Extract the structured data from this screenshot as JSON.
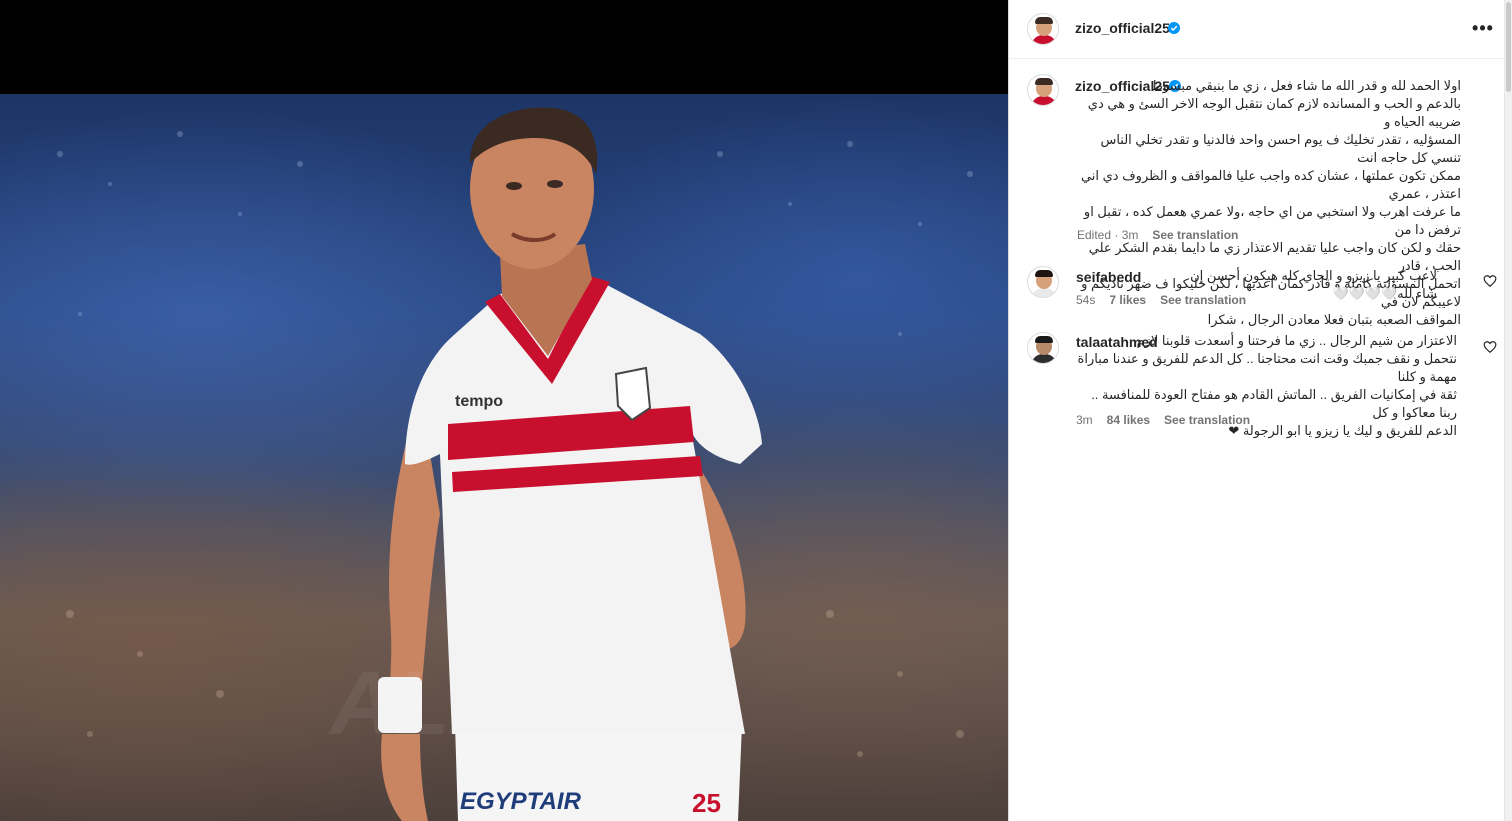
{
  "post": {
    "author": "zizo_official25",
    "verified": true,
    "caption": "اولا الحمد لله و قدر الله ما شاء فعل ، زي ما بنبقي مبسوط\nبالدعم و الحب و المسانده لازم كمان نتقبل الوجه الاخر السئ و هي دي ضريبه الحياه و\nالمسؤليه ، تقدر تخليك ف يوم احسن واحد فالدنيا و تقدر تخلي الناس تنسي كل حاجه انت\nممكن تكون عملتها ، عشان كده واجب عليا فالمواقف و الظروف دي اني اعتذر ، عمري\nما عرفت اهرب ولا استخبي من اي حاجه ،ولا عمري هعمل كده ، تقبل او ترفض دا من\nحقك و لكن كان واجب عليا تقديم الاعتذار زي ما دايما بقدم الشكر علي الحب ، قادر\nاتحمل المسؤليه كامله و قادر كمان اعديها ، لكن خليكوا ف ضهر ناديكم و لاعيبكم لان في\nالمواقف الصعبه بتبان فعلا معادن الرجال ، شكرا",
    "edited_label": "Edited · 3m",
    "see_translation": "See translation"
  },
  "comments": [
    {
      "username": "seifabedd",
      "text": "لاعب كبير يا زيزو و الجاي كله هيكون أحسن إن شاء لله🤍🤍🤍🤍",
      "time": "54s",
      "likes": "7 likes",
      "see_translation": "See translation"
    },
    {
      "username": "talaatahmed",
      "text": "الاعتزار من شيم الرجال .. زي ما فرحتنا و أسعدت قلوبنا لازم\nنتحمل و نقف جمبك وقت انت محتاجنا .. كل الدعم للفريق و عندنا مباراة مهمة و كلنا\nثقة في إمكانيات الفريق .. الماتش القادم هو مفتاح العودة للمنافسة .. ربنا معاكوا و كل\nالدعم للفريق و ليك يا زيزو يا ابو الرجولة ❤",
      "time": "3m",
      "likes": "84 likes",
      "see_translation": "See translation"
    }
  ],
  "media": {
    "shirt_sponsor": "tempo",
    "shorts_sponsor": "EGYPTAIR",
    "shirt_number": "25"
  },
  "icons": {
    "verified": "verified-badge-icon",
    "more": "more-options-icon",
    "like": "heart-icon"
  },
  "colors": {
    "verified_blue": "#0095f6",
    "jersey_red": "#c8102e",
    "meta_gray": "#737373"
  }
}
